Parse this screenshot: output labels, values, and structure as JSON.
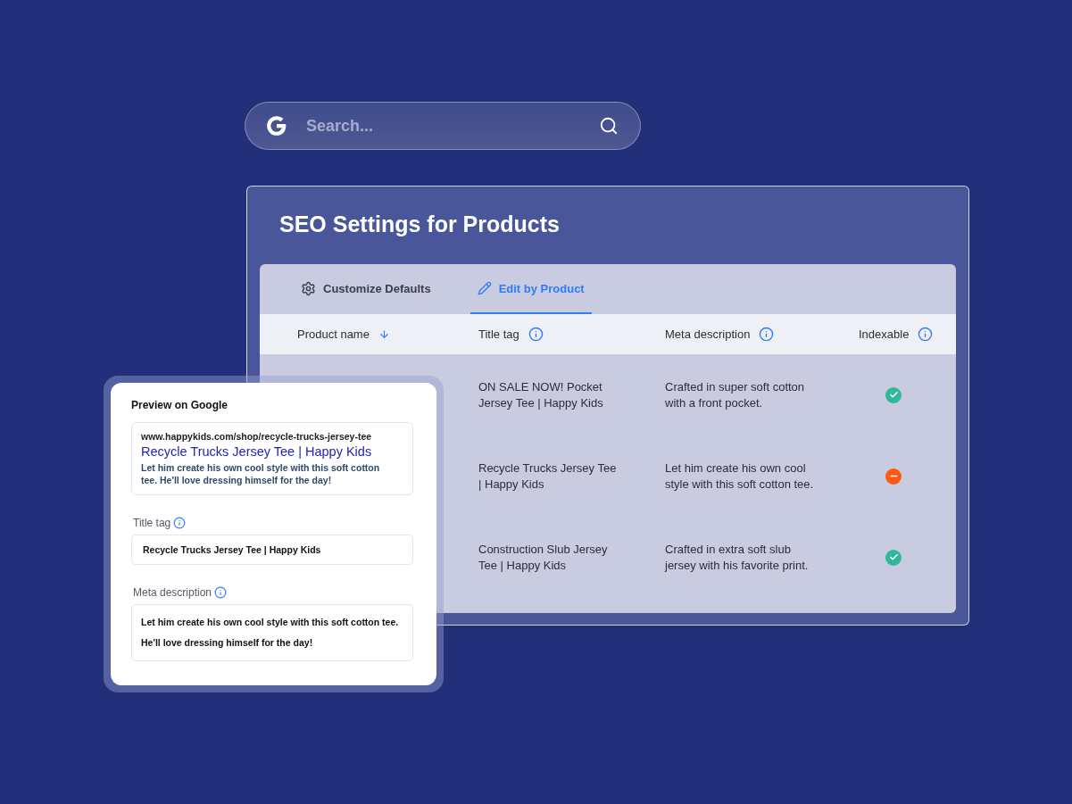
{
  "search": {
    "placeholder": "Search..."
  },
  "panel": {
    "title": "SEO Settings for Products",
    "tabs": [
      {
        "label": "Customize Defaults",
        "kind": "gear",
        "selected": false
      },
      {
        "label": "Edit by Product",
        "kind": "pencil",
        "selected": true
      }
    ],
    "columns": [
      {
        "label": "Product name",
        "kind": "sort"
      },
      {
        "label": "Title tag",
        "kind": "info"
      },
      {
        "label": "Meta description",
        "kind": "info"
      },
      {
        "label": "Indexable",
        "kind": "info"
      }
    ],
    "rows": [
      {
        "title_tag": "ON SALE NOW! Pocket Jersey Tee | Happy Kids",
        "meta_description": "Crafted in super soft cotton with a front pocket.",
        "indexable": true
      },
      {
        "title_tag": "Recycle Trucks Jersey Tee | Happy Kids",
        "meta_description": "Let him create his own cool style with this soft cotton tee.",
        "indexable": false
      },
      {
        "title_tag": "Construction Slub Jersey Tee | Happy Kids",
        "meta_description": "Crafted in extra soft slub jersey with his favorite print.",
        "indexable": true
      }
    ]
  },
  "preview": {
    "title": "Preview on Google",
    "url": "www.happykids.com/shop/recycle-trucks-jersey-tee",
    "link": "Recycle Trucks Jersey Tee | Happy Kids",
    "snippet": "Let him create his own cool style with this soft cotton tee. He'll love dressing himself for the day!",
    "fields": [
      {
        "label": "Title tag",
        "value": "Recycle Trucks Jersey Tee | Happy Kids",
        "kind": "line"
      },
      {
        "label": "Meta description",
        "value": "Let him create his own cool style with this soft cotton tee. He'll love dressing himself for the day!",
        "kind": "area"
      }
    ]
  }
}
